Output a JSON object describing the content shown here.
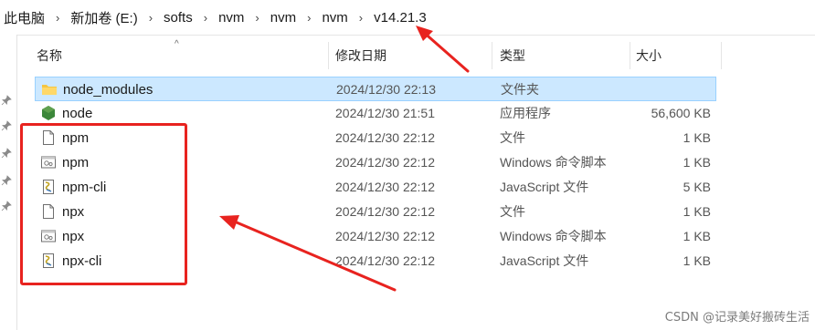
{
  "breadcrumb": {
    "items": [
      "此电脑",
      "新加卷 (E:)",
      "softs",
      "nvm",
      "nvm",
      "nvm",
      "v14.21.3"
    ],
    "separator": "›"
  },
  "columns": {
    "name": "名称",
    "date": "修改日期",
    "type": "类型",
    "size": "大小"
  },
  "files": [
    {
      "name": "node_modules",
      "date": "2024/12/30 22:13",
      "type": "文件夹",
      "size": "",
      "icon": "folder-icon",
      "selected": true
    },
    {
      "name": "node",
      "date": "2024/12/30 21:51",
      "type": "应用程序",
      "size": "56,600 KB",
      "icon": "nodejs-app-icon",
      "selected": false
    },
    {
      "name": "npm",
      "date": "2024/12/30 22:12",
      "type": "文件",
      "size": "1 KB",
      "icon": "file-icon",
      "selected": false
    },
    {
      "name": "npm",
      "date": "2024/12/30 22:12",
      "type": "Windows 命令脚本",
      "size": "1 KB",
      "icon": "cmd-script-icon",
      "selected": false
    },
    {
      "name": "npm-cli",
      "date": "2024/12/30 22:12",
      "type": "JavaScript 文件",
      "size": "5 KB",
      "icon": "js-file-icon",
      "selected": false
    },
    {
      "name": "npx",
      "date": "2024/12/30 22:12",
      "type": "文件",
      "size": "1 KB",
      "icon": "file-icon",
      "selected": false
    },
    {
      "name": "npx",
      "date": "2024/12/30 22:12",
      "type": "Windows 命令脚本",
      "size": "1 KB",
      "icon": "cmd-script-icon",
      "selected": false
    },
    {
      "name": "npx-cli",
      "date": "2024/12/30 22:12",
      "type": "JavaScript 文件",
      "size": "1 KB",
      "icon": "js-file-icon",
      "selected": false
    }
  ],
  "watermark": "CSDN @记录美好搬砖生活",
  "colors": {
    "selection_bg": "#cce8ff",
    "selection_border": "#99d1ff",
    "annotation_red": "#e8231f",
    "folder_yellow": "#f4c542",
    "node_green": "#3c873a"
  }
}
